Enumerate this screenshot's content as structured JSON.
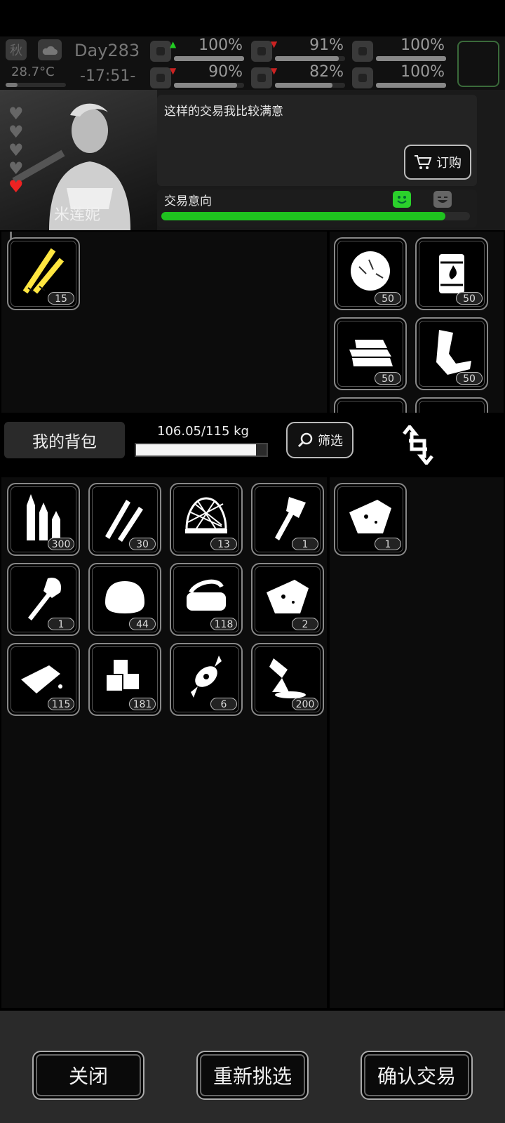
{
  "status": {
    "season": "秋",
    "temperature": "28.7°C",
    "day": "Day283",
    "time": "-17:51-",
    "stats": [
      {
        "icon": "medkit-icon",
        "value": "100%",
        "fill": 1.0,
        "trend": "up"
      },
      {
        "icon": "stomach-icon",
        "value": "91%",
        "fill": 0.91,
        "trend": "down"
      },
      {
        "icon": "energy-icon",
        "value": "100%",
        "fill": 1.0,
        "trend": "none"
      },
      {
        "icon": "leg-icon",
        "value": "90%",
        "fill": 0.9,
        "trend": "down"
      },
      {
        "icon": "water-drop-icon",
        "value": "82%",
        "fill": 0.82,
        "trend": "down"
      },
      {
        "icon": "heart-icon",
        "value": "100%",
        "fill": 1.0,
        "trend": "none"
      }
    ]
  },
  "trader": {
    "name": "米莲妮",
    "hearts": 5,
    "dialog": "这样的交易我比较满意",
    "order_label": "订购",
    "intent_label": "交易意向",
    "intent_level": 0.92
  },
  "trader_offer": [
    {
      "icon": "rods-icon",
      "count": "15"
    }
  ],
  "trader_inventory": [
    {
      "icon": "fur-ball-icon",
      "count": "50"
    },
    {
      "icon": "burning-barrel-icon",
      "count": "50"
    },
    {
      "icon": "cloth-stack-icon",
      "count": "50"
    },
    {
      "icon": "scrap-metal-icon",
      "count": "50"
    }
  ],
  "backpack": {
    "title": "我的背包",
    "weight": "106.05/115 kg",
    "weight_fill": 0.922,
    "filter_label": "筛选"
  },
  "my_items": [
    {
      "icon": "bullets-icon",
      "count": "300"
    },
    {
      "icon": "rifle-rounds-icon",
      "count": "30"
    },
    {
      "icon": "net-icon",
      "count": "13"
    },
    {
      "icon": "axe-icon",
      "count": "1"
    },
    {
      "icon": "shovel-icon",
      "count": "1"
    },
    {
      "icon": "bread-icon",
      "count": "44"
    },
    {
      "icon": "canned-food-icon",
      "count": "118"
    },
    {
      "icon": "cheese-icon",
      "count": "2"
    },
    {
      "icon": "soap-bar-icon",
      "count": "115"
    },
    {
      "icon": "sugar-cubes-icon",
      "count": "181"
    },
    {
      "icon": "candy-icon",
      "count": "6"
    },
    {
      "icon": "glue-tube-icon",
      "count": "200"
    }
  ],
  "my_offer": [
    {
      "icon": "cheese-icon",
      "count": "1"
    }
  ],
  "buttons": {
    "close": "关闭",
    "reselect": "重新挑选",
    "confirm": "确认交易"
  }
}
